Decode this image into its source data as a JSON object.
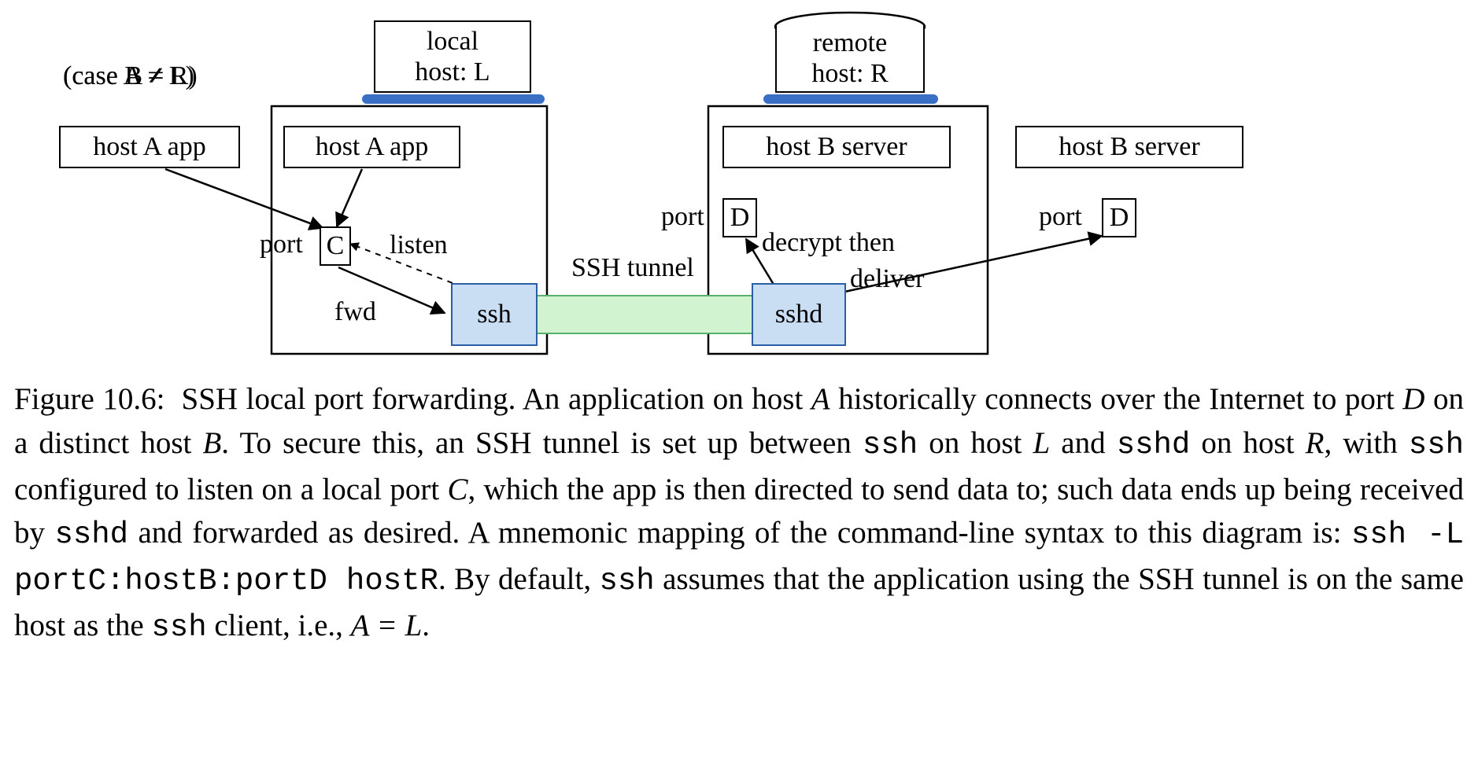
{
  "diagram": {
    "caseA": "(case A ≠ L)",
    "caseB": "(case B ≠ R)",
    "hostA_out": "host A app",
    "hostA_in": "host A app",
    "hostB_in": "host B server",
    "hostB_out": "host B server",
    "local_top": "local",
    "local_bot": "host: L",
    "remote_top": "remote",
    "remote_bot": "host: R",
    "portC_lbl": "port",
    "portC": "C",
    "portD_lbl_in": "port",
    "portD_in": "D",
    "portD_lbl_out": "port",
    "portD_out": "D",
    "listen": "listen",
    "fwd": "fwd",
    "ssh": "ssh",
    "sshd": "sshd",
    "tunnel": "SSH tunnel",
    "decrypt": "decrypt then",
    "deliver": "deliver"
  },
  "caption": {
    "fig": "Figure 10.6:",
    "p1": "SSH local port forwarding.  An application on host ",
    "A": "A",
    "p2": " historically connects over the Internet to port ",
    "D": "D",
    "p3": " on a distinct host ",
    "B": "B",
    "p4": ".  To secure this, an SSH tunnel is set up between ",
    "ssh1": "ssh",
    "p5": " on host ",
    "L": "L",
    "p6": " and ",
    "sshd1": "sshd",
    "p7": " on host ",
    "R": "R",
    "p8": ", with ",
    "ssh2": "ssh",
    "p9": " configured to listen on a local port ",
    "C": "C",
    "p10": ", which the app is then directed to send data to; such data ends up being received by ",
    "sshd2": "sshd",
    "p11": " and forwarded as desired.  A mnemonic mapping of the command-line syntax to this diagram is: ",
    "cmd": "ssh -L portC:hostB:portD hostR",
    "p12": ". By default, ",
    "ssh3": "ssh",
    "p13": " assumes that the application using the SSH tunnel is on the same host as the ",
    "ssh4": "ssh",
    "p14": " client, i.e., ",
    "AL": "A = L",
    "dot": "."
  }
}
